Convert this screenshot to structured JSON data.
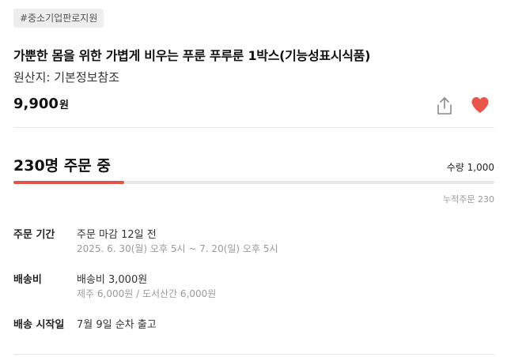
{
  "tag": "#중소기업판로지원",
  "product": {
    "title": "가뿐한 몸을 위한 가볍게 비우는 푸룬 푸루룬 1박스(기능성표시식품)",
    "origin": "원산지: 기본정보참조",
    "price": "9,900",
    "price_unit": "원"
  },
  "icons": {
    "share": "share-icon",
    "like": "heart-icon"
  },
  "colors": {
    "accent": "#e0544a",
    "heart": "#e8554a"
  },
  "order": {
    "count_text": "230명 주문 중",
    "quantity_label": "수량",
    "quantity_value": "1,000",
    "cumulative_label": "누적주문",
    "cumulative_value": "230",
    "progress_fraction": 0.23
  },
  "details": {
    "period": {
      "label": "주문 기간",
      "main": "주문 마감 12일 전",
      "sub": "2025. 6. 30(월) 오후 5시 ~ 7. 20(일) 오후 5시"
    },
    "shipping_fee": {
      "label": "배송비",
      "main": "배송비 3,000원",
      "sub": "제주 6,000원 / 도서산간 6,000원"
    },
    "shipping_start": {
      "label": "배송 시작일",
      "main": "7월 9일 순차 출고"
    }
  }
}
